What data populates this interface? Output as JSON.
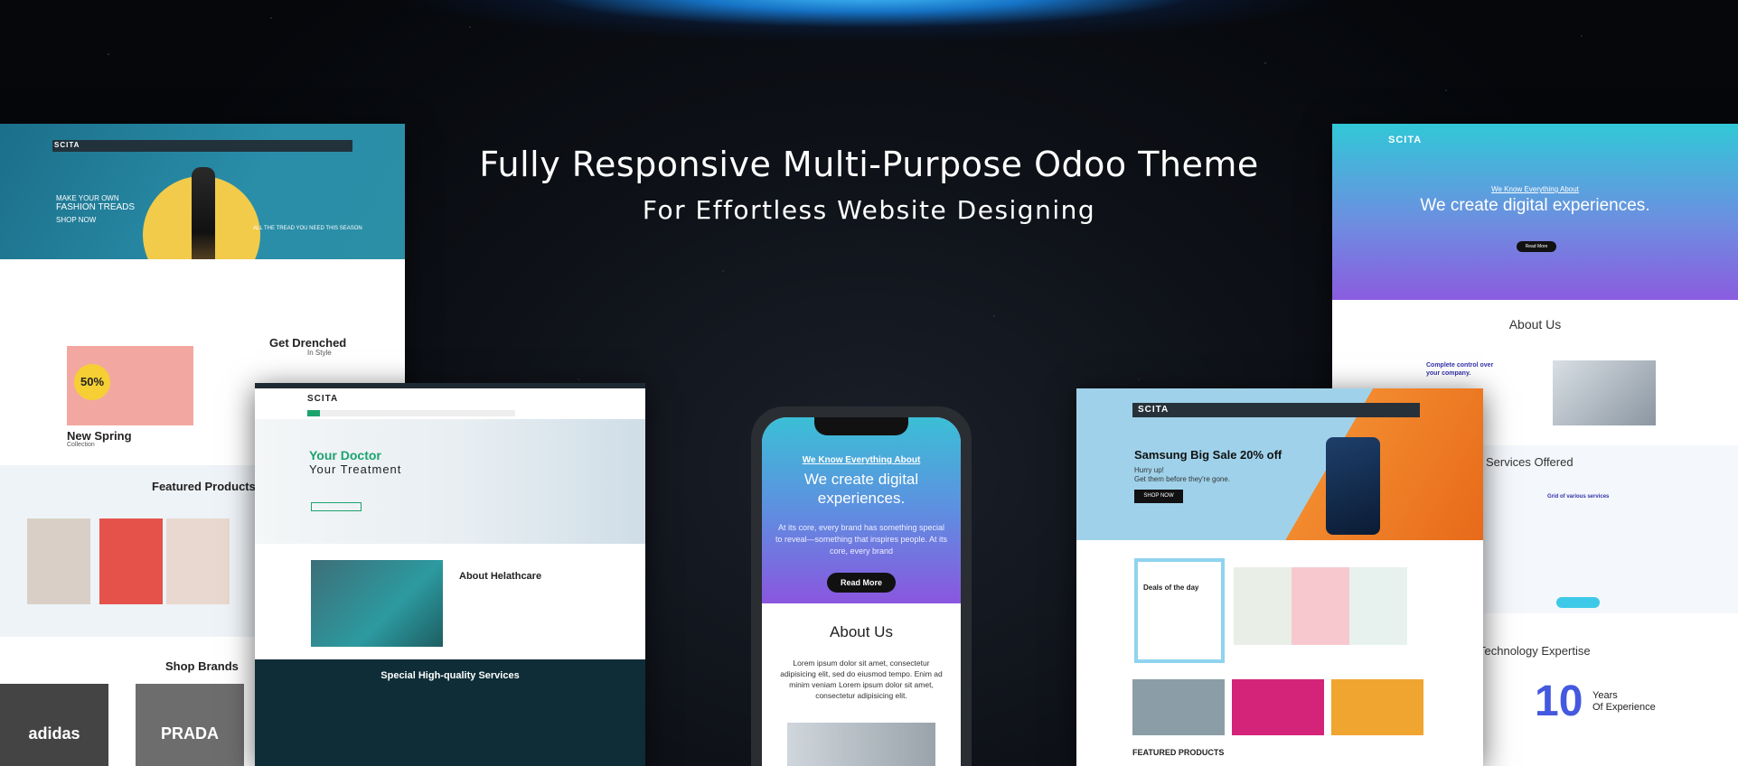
{
  "hero": {
    "title": "Fully Responsive Multi-Purpose Odoo Theme",
    "subtitle": "For Effortless Website Designing"
  },
  "shop_screen": {
    "logo": "SCITA",
    "hero_eyebrow": "MAKE YOUR OWN",
    "hero_title": "FASHION TREADS",
    "hero_cta": "SHOP NOW",
    "hero_tagline": "ALL THE TREAD YOU NEED THIS SEASON",
    "badge": "50%",
    "promo_title": "Get Drenched",
    "promo_sub": "In Style",
    "collection_title": "New Spring",
    "collection_sub": "Collection",
    "featured_heading": "Featured Products",
    "brands_heading": "Shop Brands",
    "brands": [
      "adidas",
      "PRADA"
    ]
  },
  "health_screen": {
    "logo": "SCITA",
    "hero_title": "Your Doctor",
    "hero_sub": "Your Treatment",
    "about_heading": "About Helathcare",
    "services_heading": "Special High-quality Services"
  },
  "phone_screen": {
    "eyebrow": "We Know Everything About",
    "headline": "We create digital experiences.",
    "body": "At its core, every brand has something special to reveal—something that inspires people. At its core, every brand",
    "cta": "Read More",
    "about_heading": "About Us",
    "lorem": "Lorem ipsum dolor sit amet, consectetur adipisicing elit, sed do eiusmod tempo. Enim ad minim veniam Lorem ipsum dolor sit amet, consectetur adipisicing elit."
  },
  "electronics_screen": {
    "logo": "SCITA",
    "sale_title": "Samsung Big Sale 20% off",
    "sale_sub": "Hurry up!\nGet them before they're gone.",
    "cta": "SHOP NOW",
    "deal_title": "Deals of the day",
    "featured_heading": "FEATURED PRODUCTS"
  },
  "digital_screen": {
    "logo": "SCITA",
    "eyebrow": "We Know Everything About",
    "headline": "We create digital experiences.",
    "cta": "Read More",
    "about_heading": "About Us",
    "complete_control": "Complete control over\nyour company.",
    "services_heading": "Services Offered",
    "grid_heading": "Grid of various services",
    "tech_heading": "Technology Expertise",
    "years_value": "10",
    "years_label": "Years\nOf Experience"
  }
}
